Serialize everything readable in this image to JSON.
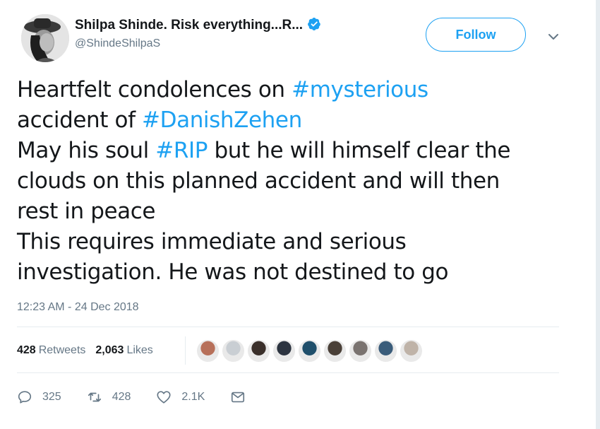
{
  "author": {
    "display_name": "Shilpa Shinde. Risk everything...R...",
    "handle": "@ShindeShilpaS",
    "verified": true
  },
  "follow_button": {
    "label": "Follow"
  },
  "tweet_text": {
    "lines": [
      [
        {
          "t": "Heartfelt condolences on ",
          "tag": false
        },
        {
          "t": "#mysterious",
          "tag": true
        }
      ],
      [
        {
          "t": "accident of ",
          "tag": false
        },
        {
          "t": "#DanishZehen",
          "tag": true
        }
      ],
      [
        {
          "t": "May his soul ",
          "tag": false
        },
        {
          "t": "#RIP",
          "tag": true
        },
        {
          "t": " but he will himself clear the",
          "tag": false
        }
      ],
      [
        {
          "t": "clouds on this planned accident and will then",
          "tag": false
        }
      ],
      [
        {
          "t": "rest in peace",
          "tag": false
        }
      ],
      [
        {
          "t": "This requires immediate and serious",
          "tag": false
        }
      ],
      [
        {
          "t": "investigation. He was not destined to go",
          "tag": false
        }
      ]
    ]
  },
  "timestamp": "12:23 AM - 24 Dec 2018",
  "stats": {
    "retweets_count": "428",
    "retweets_label": "Retweets",
    "likes_count": "2,063",
    "likes_label": "Likes"
  },
  "likers": [
    {
      "color": "#b7705a"
    },
    {
      "color": "#c9ced3"
    },
    {
      "color": "#3a2f2a"
    },
    {
      "color": "#2c3440"
    },
    {
      "color": "#1f4f6b"
    },
    {
      "color": "#4a4038"
    },
    {
      "color": "#7a7370"
    },
    {
      "color": "#3a5c7a"
    },
    {
      "color": "#bfb3a8"
    }
  ],
  "actions": {
    "replies": "325",
    "retweets": "428",
    "likes": "2.1K"
  },
  "colors": {
    "accent": "#1da1f2",
    "text": "#14171a",
    "muted": "#657786",
    "divider": "#e6ecf0"
  }
}
